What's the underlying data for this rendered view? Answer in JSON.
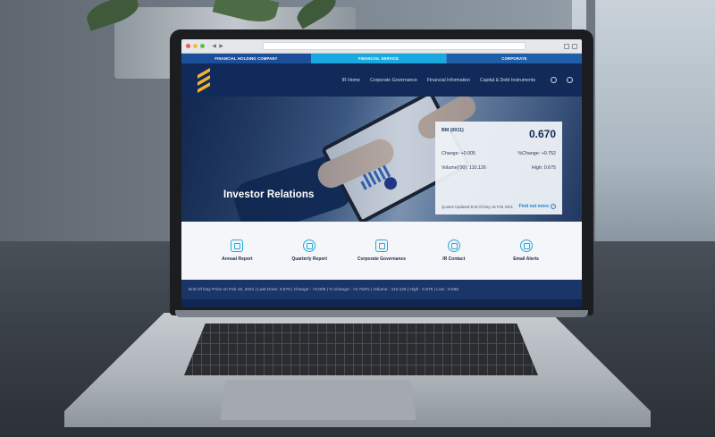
{
  "top_strip": {
    "left": "FINANCIAL HOLDING COMPANY",
    "middle": "FINANCIAL SERVICE",
    "right": "CORPORATE"
  },
  "nav": {
    "items": [
      "IR Home",
      "Corporate Governance",
      "Financial Information",
      "Capital & Debt Instruments"
    ],
    "icons": [
      "search-icon",
      "globe-icon"
    ]
  },
  "hero": {
    "title": "Investor Relations"
  },
  "quote": {
    "symbol": "BM (0011)",
    "price": "0.670",
    "change": "Change: +0.005",
    "pct_change": "%Change: +0.752",
    "volume": "Volume('00): 110,126",
    "high": "High: 0.675",
    "updated": "Quotes Updated End Of Day 16 Feb 2021",
    "link": "Find out more"
  },
  "quick_links": [
    {
      "label": "Annual Report",
      "icon": "report-icon"
    },
    {
      "label": "Quarterly Report",
      "icon": "pie-chart-icon"
    },
    {
      "label": "Corporate Governance",
      "icon": "chart-icon"
    },
    {
      "label": "IR Contact",
      "icon": "phone-icon"
    },
    {
      "label": "Email Alerts",
      "icon": "bell-icon"
    }
  ],
  "ticker": "End Of Day Price on Feb 16, 2021  |  Last Done: 0.670  |  Change : +0.005  |  % Change : +0.752%  |  Volume : 110,126  |  High : 0.675  |  Low : 0.660",
  "colors": {
    "header": "#112a59",
    "accent_cyan": "#1aa9df",
    "brand_gold": "#f2b430"
  }
}
